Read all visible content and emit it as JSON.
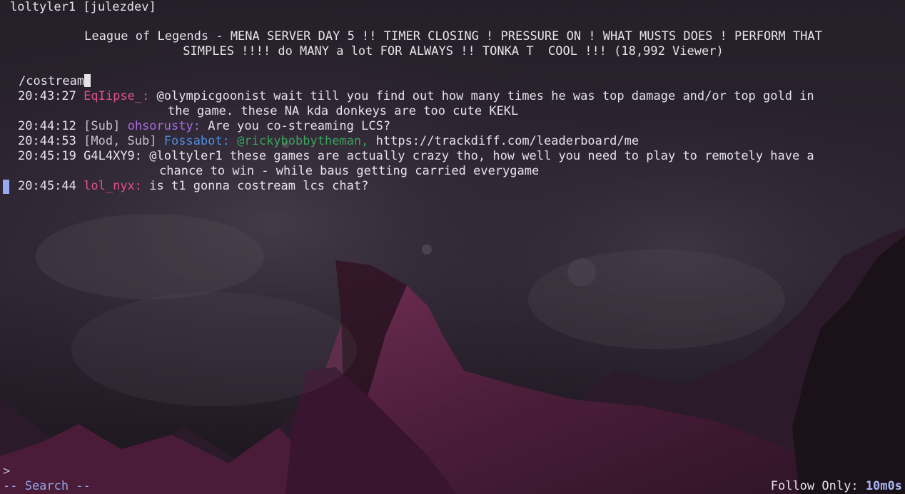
{
  "window": {
    "title": "loltyler1 [julezdev]"
  },
  "stream": {
    "title_line1": "League of Legends - MENA SERVER DAY 5 !! TIMER CLOSING ! PRESSURE ON ! WHAT MUSTS DOES ! PERFORM THAT",
    "title_line2": "SIMPLES !!!! do MANY a lot FOR ALWAYS !! TONKA T  COOL !!! (18,992 Viewer)"
  },
  "search": {
    "query": "/costream"
  },
  "messages": [
    {
      "time": "20:43:27",
      "badges": "",
      "user": "EqIipse_",
      "user_color": "#e0508a",
      "text_line1": "@olympicgoonist wait till you find out how many times he was top damage and/or top gold in",
      "text_line2": "the game. these NA kda donkeys are too cute KEKL"
    },
    {
      "time": "20:44:12",
      "badges": "[Sub]",
      "user": "ohsorusty",
      "user_color": "#a76ae0",
      "text_line1": "Are you co-streaming LCS?"
    },
    {
      "time": "20:44:53",
      "badges": "[Mod, Sub]",
      "user": "Fossabot",
      "user_color": "#4d8ee0",
      "mention": "@rickybobbytheman,",
      "text_line1": "https://trackdiff.com/leaderboard/me"
    },
    {
      "time": "20:45:19",
      "badges": "",
      "user": "G4L4XY9",
      "user_color": "#e6e2ea",
      "text_line1": "@loltyler1 these games are actually crazy tho, how well you need to play to remotely have a",
      "text_line2": "chance to win - while baus getting carried everygame"
    },
    {
      "time": "20:45:44",
      "badges": "",
      "user": "lol_nyx",
      "user_color": "#e0508a",
      "text_line1": "is t1 gonna costream lcs chat?",
      "selected": true
    }
  ],
  "footer": {
    "prompt": ">",
    "mode": "-- Search --",
    "follow_label": "Follow Only:",
    "follow_value": "10m0s"
  },
  "colors": {
    "accent": "#9aa8f0",
    "timer": "#a7b7f5",
    "mention": "#3aa35b"
  },
  "icons": {
    "cursor": "block-cursor",
    "selection": "selection-marker"
  }
}
